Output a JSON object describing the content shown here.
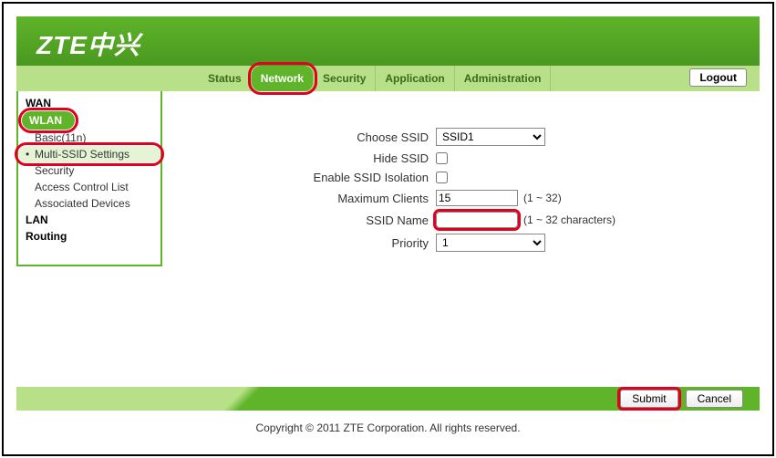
{
  "brand": "ZTE中兴",
  "tabs": {
    "status": "Status",
    "network": "Network",
    "security": "Security",
    "application": "Application",
    "administration": "Administration"
  },
  "logout": "Logout",
  "sidebar": {
    "wan": "WAN",
    "wlan": "WLAN",
    "items": {
      "basic": "Basic(11n)",
      "multi_ssid": "Multi-SSID Settings",
      "security": "Security",
      "acl": "Access Control List",
      "assoc": "Associated Devices"
    },
    "lan": "LAN",
    "routing": "Routing"
  },
  "form": {
    "choose_ssid_label": "Choose SSID",
    "choose_ssid_value": "SSID1",
    "hide_ssid_label": "Hide SSID",
    "enable_iso_label": "Enable SSID Isolation",
    "max_clients_label": "Maximum Clients",
    "max_clients_value": "15",
    "max_clients_hint": "(1 ~ 32)",
    "ssid_name_label": "SSID Name",
    "ssid_name_value": "",
    "ssid_name_hint": "(1 ~ 32 characters)",
    "priority_label": "Priority",
    "priority_value": "1"
  },
  "buttons": {
    "submit": "Submit",
    "cancel": "Cancel"
  },
  "copyright": "Copyright © 2011 ZTE Corporation. All rights reserved."
}
